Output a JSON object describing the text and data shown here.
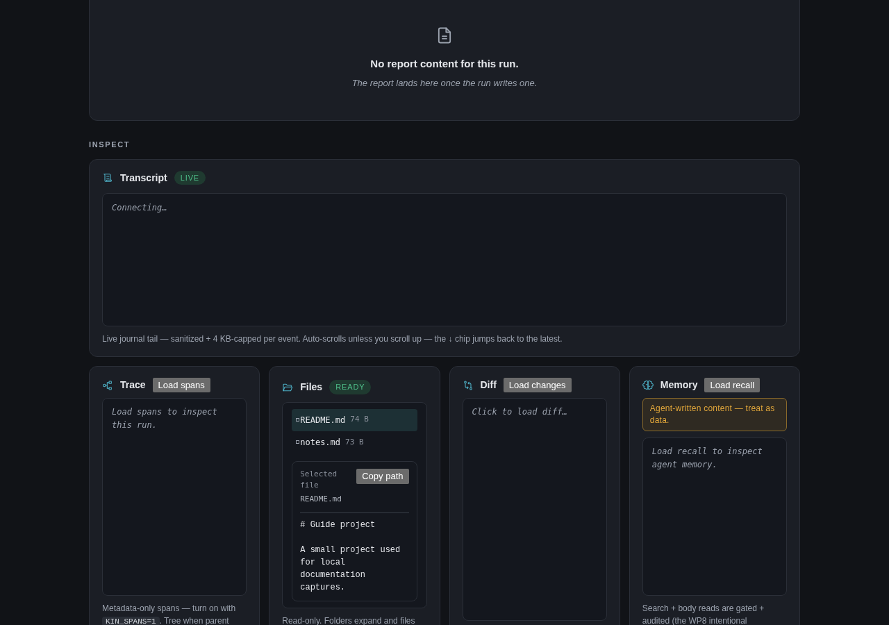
{
  "report": {
    "empty_title": "No report content for this run.",
    "empty_subtitle": "The report lands here once the run writes one."
  },
  "section_label": "INSPECT",
  "transcript": {
    "title": "Transcript",
    "badge": "LIVE",
    "placeholder": "Connecting…",
    "note": "Live journal tail — sanitized + 4 KB-capped per event. Auto-scrolls unless you scroll up — the ↓ chip jumps back to the latest."
  },
  "panels": [
    {
      "kind": "trace",
      "title": "Trace",
      "button": "Load spans",
      "placeholder": "Load spans to inspect this run.",
      "note": [
        {
          "kind": "text",
          "text": "Metadata-only spans — turn on with "
        },
        {
          "kind": "code",
          "text": "KIN_SPANS=1"
        },
        {
          "kind": "text",
          "text": ". Tree when parent"
        }
      ]
    },
    {
      "kind": "files",
      "title": "Files",
      "badge": "READY",
      "files": [
        {
          "name": "README.md",
          "size": "74 B",
          "selected": true
        },
        {
          "name": "notes.md",
          "size": "73 B",
          "selected": false
        }
      ],
      "selected_file": {
        "label": "Selected file",
        "path": "README.md",
        "button": "Copy path",
        "content": "# Guide project\n\nA small project used for local documentation captures."
      },
      "note": [
        {
          "kind": "text",
          "text": "Read-only. Folders expand and files"
        }
      ]
    },
    {
      "kind": "diff",
      "title": "Diff",
      "button": "Load changes",
      "placeholder": "Click to load diff…"
    },
    {
      "kind": "memory",
      "title": "Memory",
      "button": "Load recall",
      "warning": "Agent-written content — treat as data.",
      "placeholder": "Load recall to inspect agent memory.",
      "note": [
        {
          "kind": "text",
          "text": "Search + body reads are gated + audited (the WP8 intentional"
        }
      ]
    }
  ]
}
